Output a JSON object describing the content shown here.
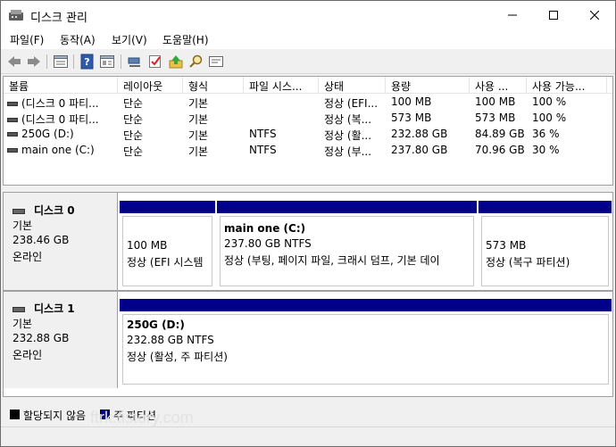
{
  "window": {
    "title": "디스크 관리"
  },
  "menu": [
    "파일(F)",
    "동작(A)",
    "보기(V)",
    "도움말(H)"
  ],
  "volume_list": {
    "columns": [
      "볼륨",
      "레이아웃",
      "형식",
      "파일 시스...",
      "상태",
      "용량",
      "사용 ...",
      "사용 가능..."
    ],
    "rows": [
      [
        "(디스크 0 파티...",
        "단순",
        "기본",
        "",
        "정상 (EFI...",
        "100 MB",
        "100 MB",
        "100 %"
      ],
      [
        "(디스크 0 파티...",
        "단순",
        "기본",
        "",
        "정상 (복...",
        "573 MB",
        "573 MB",
        "100 %"
      ],
      [
        "250G (D:)",
        "단순",
        "기본",
        "NTFS",
        "정상 (활...",
        "232.88 GB",
        "84.89 GB",
        "36 %"
      ],
      [
        "main one (C:)",
        "단순",
        "기본",
        "NTFS",
        "정상 (부...",
        "237.80 GB",
        "70.96 GB",
        "30 %"
      ]
    ]
  },
  "disks": [
    {
      "name": "디스크 0",
      "type": "기본",
      "size": "238.46 GB",
      "status": "온라인",
      "partitions": [
        {
          "name": "",
          "size": "100 MB",
          "status": "정상 (EFI 시스템"
        },
        {
          "name": "main one  (C:)",
          "size": "237.80 GB NTFS",
          "status": "정상 (부팅, 페이지 파일, 크래시 덤프, 기본 데이"
        },
        {
          "name": "",
          "size": "573 MB",
          "status": "정상 (복구 파티션)"
        }
      ]
    },
    {
      "name": "디스크 1",
      "type": "기본",
      "size": "232.88 GB",
      "status": "온라인",
      "partitions": [
        {
          "name": "250G  (D:)",
          "size": "232.88 GB NTFS",
          "status": "정상 (활성, 주 파티션)"
        }
      ]
    }
  ],
  "legend": [
    {
      "label": "할당되지 않음",
      "color": "#000000"
    },
    {
      "label": "주 파티션",
      "color": "#00008b"
    }
  ],
  "watermark": "ftrk.tistory.com",
  "colors": {
    "partition_bar": "#00008b",
    "unallocated": "#000000"
  },
  "toolbar_icons": [
    "back-arrow-icon",
    "forward-arrow-icon",
    "list-view-icon",
    "help-icon",
    "properties-icon",
    "connect-icon",
    "check-icon",
    "up-icon",
    "search-icon",
    "console-icon"
  ]
}
